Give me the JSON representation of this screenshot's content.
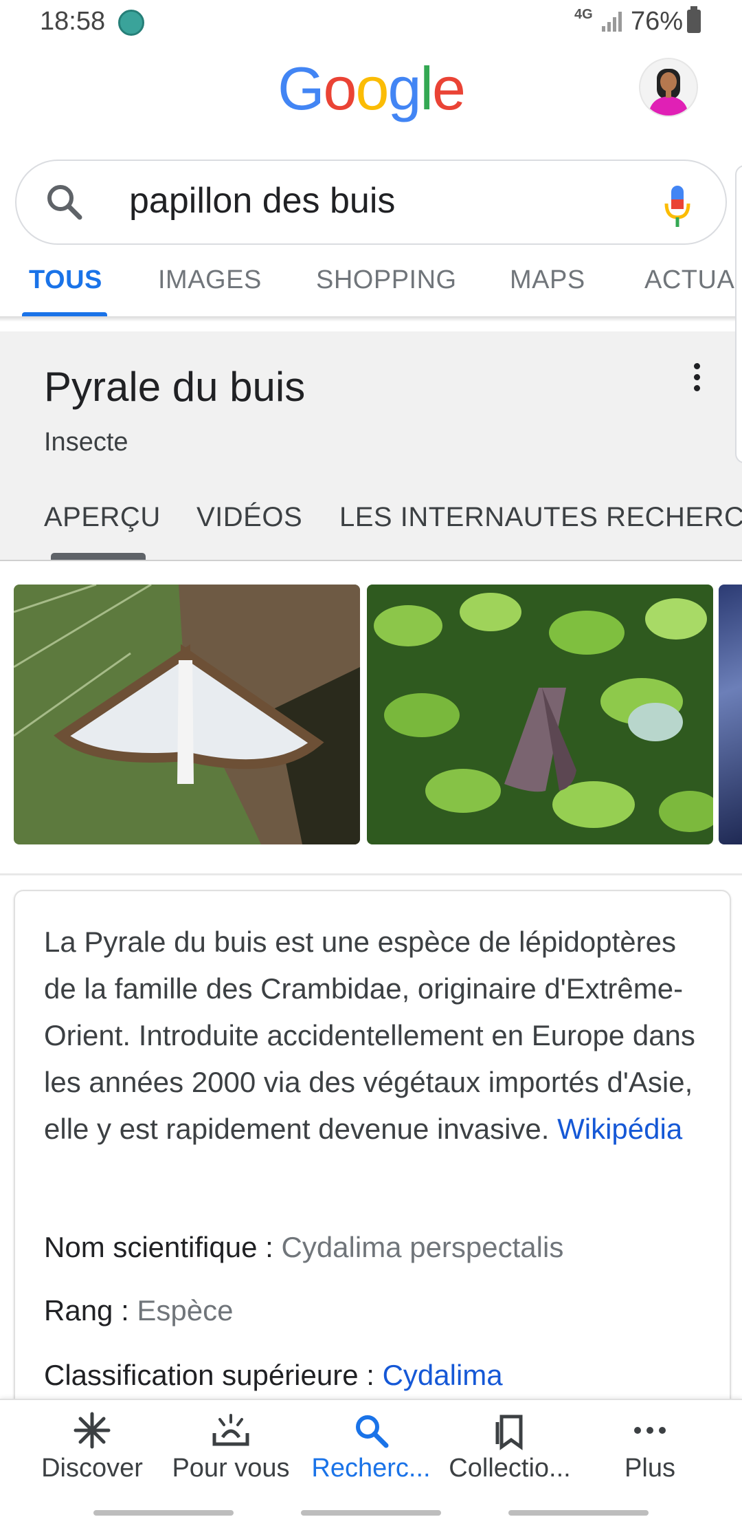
{
  "status_bar": {
    "time": "18:58",
    "network": "4G",
    "battery": "76%"
  },
  "header": {
    "logo_letters": [
      "G",
      "o",
      "o",
      "g",
      "l",
      "e"
    ],
    "logo_colors": [
      "#4285F4",
      "#EA4335",
      "#FBBC05",
      "#4285F4",
      "#34A853",
      "#EA4335"
    ]
  },
  "search": {
    "query": "papillon des buis"
  },
  "tabs": [
    "TOUS",
    "IMAGES",
    "SHOPPING",
    "MAPS",
    "ACTUA"
  ],
  "knowledge_panel": {
    "title": "Pyrale du buis",
    "subtitle": "Insecte",
    "tabs": [
      "APERÇU",
      "VIDÉOS",
      "LES INTERNAUTES RECHERCH"
    ]
  },
  "description": {
    "text": "La Pyrale du buis est une espèce de lépidoptères de la famille des Crambidae, originaire d'Extrême-Orient. Introduite accidentellement en Europe dans les années 2000 via des végétaux importés d'Asie, elle y est rapidement devenue invasive.",
    "source": "Wikipédia"
  },
  "facts": [
    {
      "label": "Nom scientifique : ",
      "value": "Cydalima perspectalis"
    },
    {
      "label": "Rang : ",
      "value": "Espèce"
    },
    {
      "label": "Classification supérieure : ",
      "value": "Cydalima"
    }
  ],
  "bottom_nav": [
    "Discover",
    "Pour vous",
    "Recherc...",
    "Collectio...",
    "Plus"
  ],
  "colors": {
    "accent": "#1a73e8",
    "link": "#1558d6"
  }
}
